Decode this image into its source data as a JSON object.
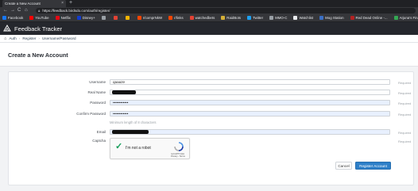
{
  "browser": {
    "tab_title": "Create a New Account",
    "tab_close": "×",
    "new_tab": "+",
    "url": "https://feedback.birdsdo.com/auth/register/",
    "nav": {
      "back": "←",
      "forward": "→",
      "reload": "C",
      "home": "⌂"
    },
    "bookmarks": [
      {
        "label": "Facebook",
        "color": "#1877f2"
      },
      {
        "label": "YouTube",
        "color": "#ff0000"
      },
      {
        "label": "Netflix",
        "color": "#e50914"
      },
      {
        "label": "Disney+",
        "color": "#113ccf"
      },
      {
        "label": "",
        "color": "#9aa0a6"
      },
      {
        "label": "",
        "color": "#e34234"
      },
      {
        "label": "",
        "color": "#f4b400"
      },
      {
        "label": "r/comprNkW",
        "color": "#ff4500"
      },
      {
        "label": "r/links",
        "color": "#ff4500"
      },
      {
        "label": "watchedbets",
        "color": "#e34234"
      },
      {
        "label": "RaidBots",
        "color": "#d4af37"
      },
      {
        "label": "Twitter",
        "color": "#1da1f2"
      },
      {
        "label": "MMO-C",
        "color": "#9aa0a6"
      },
      {
        "label": "Watchlist",
        "color": "#e8eaed"
      },
      {
        "label": "Mog Station",
        "color": "#3b6fc4"
      },
      {
        "label": "Red Dead Online -...",
        "color": "#b22222"
      },
      {
        "label": "Arjuna's Final Fanta...",
        "color": "#34a853"
      },
      {
        "label": "Collezioni",
        "color": "#f4b400"
      }
    ]
  },
  "app": {
    "title": "Feedback Tracker"
  },
  "breadcrumb": {
    "items": [
      "Auth",
      "Register",
      "Username/Password"
    ],
    "sep": "›"
  },
  "page": {
    "title": "Create a New Account"
  },
  "form": {
    "fields": [
      {
        "label": "Username",
        "value": "qaaaze",
        "type": "text",
        "required": "Required"
      },
      {
        "label": "Real Name",
        "value": "",
        "type": "redacted",
        "required": "Required"
      },
      {
        "label": "Password",
        "value": "••••••••••••",
        "type": "password",
        "required": "Required"
      },
      {
        "label": "Confirm Password",
        "value": "••••••••••••",
        "type": "password",
        "required": "Required"
      },
      {
        "label": "Email",
        "value": "",
        "type": "redacted",
        "required": "Required"
      }
    ],
    "password_hint": "Minimum length of 8 characters",
    "captcha_label": "Captcha",
    "captcha_required": "Required",
    "recaptcha": {
      "check": "✓",
      "label": "I'm not a robot",
      "brand": "reCAPTCHA",
      "links": "Privacy - Terms"
    },
    "cancel_label": "Cancel",
    "submit_label": "Register Account"
  }
}
